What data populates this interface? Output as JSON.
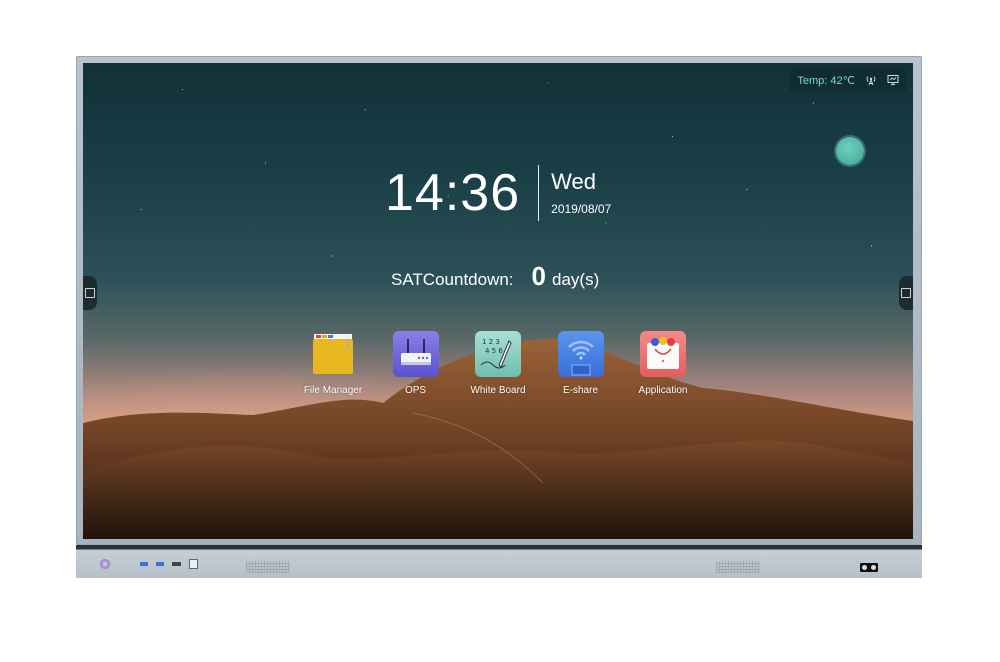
{
  "status_bar": {
    "temp_label": "Temp:",
    "temp_value": "42℃",
    "icons": [
      "signal-tower-icon",
      "screen-cast-icon"
    ]
  },
  "clock": {
    "time": "14:36",
    "weekday": "Wed",
    "date": "2019/08/07"
  },
  "countdown": {
    "label": "SATCountdown:",
    "value": "0",
    "unit": "day(s)"
  },
  "apps": [
    {
      "label": "File Manager",
      "icon": "folder-icon",
      "color": "#e8b820"
    },
    {
      "label": "OPS",
      "icon": "router-icon",
      "color": "#6d63d8"
    },
    {
      "label": "White Board",
      "icon": "whiteboard-pen-icon",
      "color": "#8ed3c3"
    },
    {
      "label": "E-share",
      "icon": "wifi-screen-icon",
      "color": "#3f7fe0"
    },
    {
      "label": "Application",
      "icon": "app-bag-icon",
      "color": "#ef6f6f"
    }
  ],
  "colors": {
    "status_text": "#7fd6c8",
    "float_ball": "#4fb6a5",
    "bezel": "#b3bdc7"
  }
}
